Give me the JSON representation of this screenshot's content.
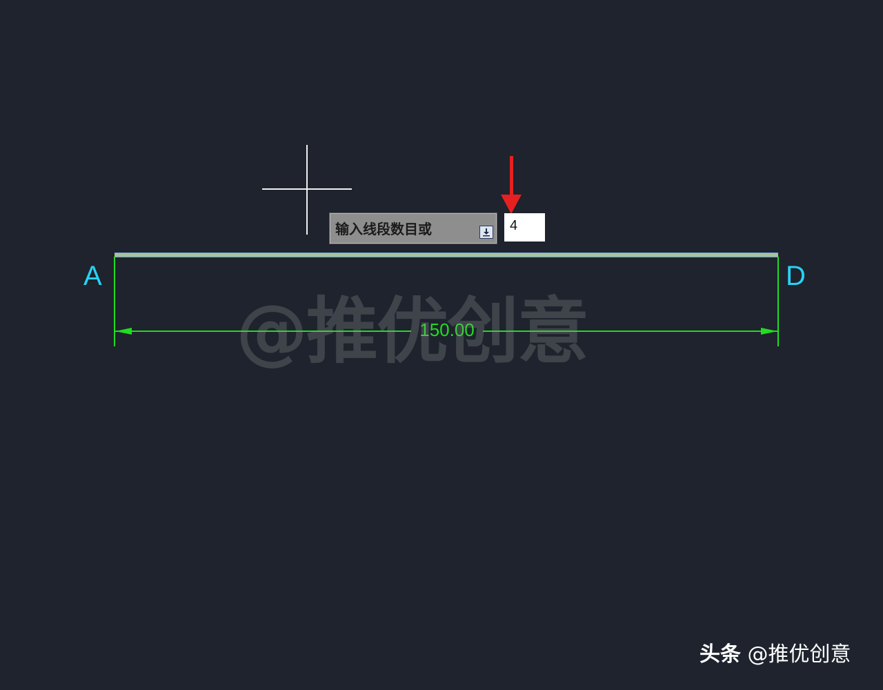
{
  "colors": {
    "background": "#1e232d",
    "crosshair": "#f2f2f2",
    "prompt_bg": "#8e8e8e",
    "input_bg": "#ffffff",
    "arrow": "#e52020",
    "line": "#a8c29a",
    "point_label": "#27d3f5",
    "dimension": "#20dd20"
  },
  "command_prompt": {
    "text": "输入线段数目或",
    "icon": "download-arrow-icon",
    "input_value": "4"
  },
  "annotation": {
    "icon": "red-arrow-down-icon"
  },
  "drawing": {
    "point_start": "A",
    "point_end": "D",
    "dimension_value": "150.00"
  },
  "watermark": {
    "text": "@推优创意"
  },
  "footer": {
    "brand": "头条",
    "handle": "@推优创意"
  }
}
